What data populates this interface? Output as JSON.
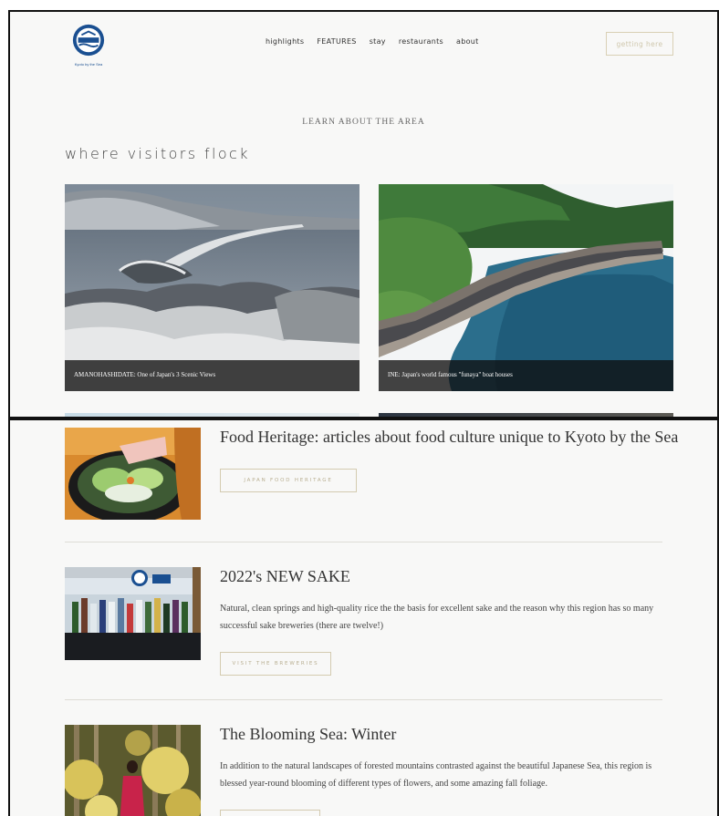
{
  "site": {
    "logo_text": "Kyoto by the Sea",
    "brand_color": "#1a4f91"
  },
  "nav": {
    "items": [
      "highlights",
      "FEATURES",
      "stay",
      "restaurants",
      "about"
    ],
    "getting_here": "getting here"
  },
  "area": {
    "kicker": "LEARN ABOUT THE AREA",
    "title": "where visitors flock",
    "cards": [
      {
        "caption": "AMANOHASHIDATE: One of Japan's 3 Scenic Views"
      },
      {
        "caption": "INE: Japan's world famous \"funaya\" boat houses"
      }
    ]
  },
  "articles": [
    {
      "title": "Food Heritage: articles about food culture unique to Kyoto by the Sea",
      "cta": "JAPAN FOOD HERITAGE"
    },
    {
      "title": "2022's NEW SAKE",
      "body": "Natural, clean springs and high-quality rice the the basis for excellent sake and the reason why this region has so many successful sake breweries (there are twelve!)",
      "cta": "VISIT THE BREWERIES"
    },
    {
      "title": "The Blooming Sea: Winter",
      "body": "In addition to the natural landscapes of forested mountains contrasted against the beautiful Japanese Sea, this region is blessed year-round blooming of different types of flowers, and some amazing fall foliage."
    }
  ]
}
